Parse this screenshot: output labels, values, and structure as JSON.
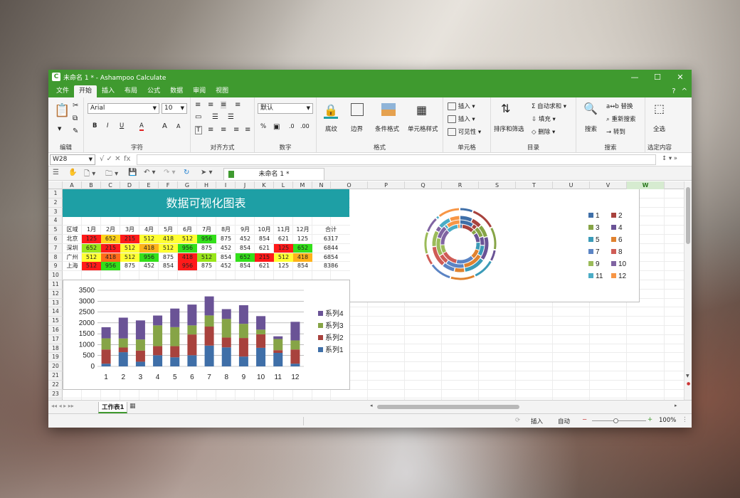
{
  "titlebar": {
    "app_letter": "C",
    "title": "未命名 1 * - Ashampoo Calculate",
    "minimize": "—",
    "maximize": "☐",
    "close": "✕"
  },
  "menu": {
    "tabs": [
      "文件",
      "开始",
      "插入",
      "布局",
      "公式",
      "数据",
      "审阅",
      "视图"
    ],
    "active": "开始",
    "help": "?",
    "collapse": "^"
  },
  "ribbon": {
    "clipboard_label": "编辑",
    "font": {
      "name": "Arial",
      "size": "10",
      "label": "字符",
      "bold": "B",
      "italic": "I",
      "underline": "U",
      "fontcolor": "A",
      "grow": "A",
      "shrink": "A"
    },
    "align": {
      "label": "对齐方式"
    },
    "number": {
      "format": "默认",
      "label": "数字",
      "percent": "%"
    },
    "format": {
      "shading": "底纹",
      "border": "边界",
      "cond": "条件格式",
      "cellstyle": "单元格样式",
      "label": "格式"
    },
    "cells": {
      "insert1": "插入",
      "insert2": "插入",
      "visible": "可见性",
      "label": "单元格"
    },
    "catalog": {
      "sort": "排序和筛选",
      "autosum": "自动求和",
      "fill": "填充",
      "delete": "删除",
      "label": "目录"
    },
    "search": {
      "search": "搜索",
      "replace": "替换",
      "research": "重新搜索",
      "goto": "转到",
      "label": "搜索"
    },
    "select": {
      "all": "全选",
      "label": "选定内容"
    }
  },
  "formula": {
    "cellref": "W28",
    "value": ""
  },
  "toolbar": {
    "doc_tab": "未命名 1 *"
  },
  "columns": [
    "A",
    "B",
    "C",
    "D",
    "E",
    "F",
    "G",
    "H",
    "I",
    "J",
    "K",
    "L",
    "M",
    "N",
    "O",
    "P",
    "Q",
    "R",
    "S",
    "T",
    "U",
    "V",
    "W"
  ],
  "rows": [
    "1",
    "2",
    "3",
    "4",
    "5",
    "6",
    "7",
    "8",
    "9",
    "10",
    "11",
    "12",
    "13",
    "14",
    "15",
    "16",
    "17",
    "18",
    "19",
    "20",
    "21",
    "22",
    "23"
  ],
  "table": {
    "title": "数据可视化图表",
    "header": [
      "区域",
      "1月",
      "2月",
      "3月",
      "4月",
      "5月",
      "6月",
      "7月",
      "8月",
      "9月",
      "10月",
      "11月",
      "12月",
      "合计"
    ],
    "rows": [
      [
        "北京",
        "125",
        "652",
        "215",
        "512",
        "418",
        "512",
        "956",
        "875",
        "452",
        "854",
        "621",
        "125",
        "6317"
      ],
      [
        "深圳",
        "652",
        "215",
        "512",
        "418",
        "512",
        "956",
        "875",
        "452",
        "854",
        "621",
        "125",
        "652",
        "6844"
      ],
      [
        "广州",
        "512",
        "418",
        "512",
        "956",
        "875",
        "418",
        "512",
        "854",
        "652",
        "215",
        "512",
        "418",
        "6854"
      ],
      [
        "上海",
        "512",
        "956",
        "875",
        "452",
        "854",
        "956",
        "875",
        "452",
        "854",
        "621",
        "125",
        "854",
        "8386"
      ]
    ],
    "fills": [
      [
        "#ff1a1a",
        "#ffd21a",
        "#ff1a1a",
        "#ffff33",
        "#ffff33",
        "#ffff33",
        "#33e01a",
        "",
        "",
        "",
        "",
        "",
        ""
      ],
      [
        "#99e61a",
        "#ff1a1a",
        "#ffff33",
        "#ffb21a",
        "#ffff33",
        "#33e01a",
        "",
        "",
        "",
        "",
        "#ff1a1a",
        "#33e01a"
      ],
      [
        "#ffff33",
        "#ff6a1a",
        "#ffff33",
        "#33e01a",
        "",
        "#ff1a1a",
        "#99e61a",
        "",
        "#33e01a",
        "#ff1a1a",
        "#ffff33",
        "#ffb21a"
      ],
      [
        "#ff1a1a",
        "#33e01a",
        "",
        "",
        "",
        "#ff1a1a",
        "",
        "",
        "",
        "",
        "",
        ""
      ]
    ]
  },
  "chart_data": [
    {
      "type": "bar",
      "stacked": true,
      "categories": [
        "1",
        "2",
        "3",
        "4",
        "5",
        "6",
        "7",
        "8",
        "9",
        "10",
        "11",
        "12"
      ],
      "ylim": [
        0,
        3500
      ],
      "yticks": [
        0,
        500,
        1000,
        1500,
        2000,
        2500,
        3000,
        3500
      ],
      "series": [
        {
          "name": "系列1",
          "color": "#3f6fa8",
          "values": [
            125,
            652,
            215,
            512,
            418,
            512,
            956,
            875,
            452,
            854,
            621,
            125
          ]
        },
        {
          "name": "系列2",
          "color": "#a8423d",
          "values": [
            652,
            215,
            512,
            418,
            512,
            956,
            875,
            452,
            854,
            621,
            125,
            652
          ]
        },
        {
          "name": "系列3",
          "color": "#86a446",
          "values": [
            512,
            418,
            512,
            956,
            875,
            418,
            512,
            854,
            652,
            215,
            512,
            418
          ]
        },
        {
          "name": "系列4",
          "color": "#6a5396",
          "values": [
            512,
            956,
            875,
            452,
            854,
            956,
            875,
            452,
            854,
            621,
            125,
            854
          ]
        }
      ],
      "legend": "right"
    },
    {
      "type": "pie",
      "variant": "doughnut",
      "legend": [
        "1",
        "2",
        "3",
        "4",
        "5",
        "6",
        "7",
        "8",
        "9",
        "10",
        "11",
        "12"
      ],
      "colors": [
        "#3f6fa8",
        "#a8423d",
        "#86a446",
        "#6a5396",
        "#3b9bb8",
        "#e0822f",
        "#5b84c4",
        "#cf5c56",
        "#9bbb59",
        "#8064a2",
        "#4bacc6",
        "#f79646"
      ]
    }
  ],
  "sheets": {
    "tabs": [
      "工作表1"
    ]
  },
  "status": {
    "mode": "插入",
    "auto": "自动",
    "zoom": "100%",
    "minus": "−",
    "plus": "+"
  }
}
